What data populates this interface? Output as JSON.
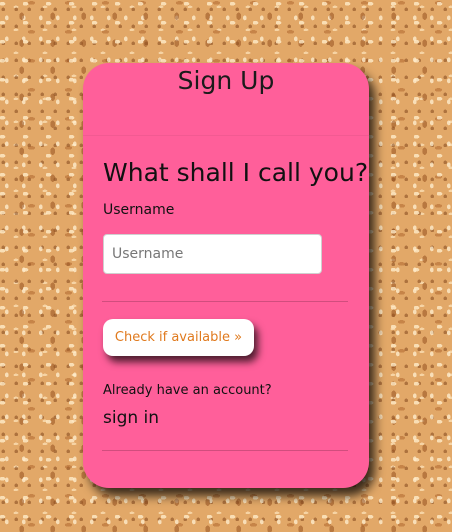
{
  "card": {
    "title": "Sign Up",
    "heading": "What shall I call you?",
    "username_label": "Username",
    "username_input": {
      "value": "",
      "placeholder": "Username"
    },
    "check_button_label": "Check if available »",
    "already_text": "Already have an account?",
    "signin_link": "sign in"
  },
  "colors": {
    "card_background": "#ff5f9a",
    "button_text": "#e07a1e",
    "page_background": "#e2a868"
  }
}
